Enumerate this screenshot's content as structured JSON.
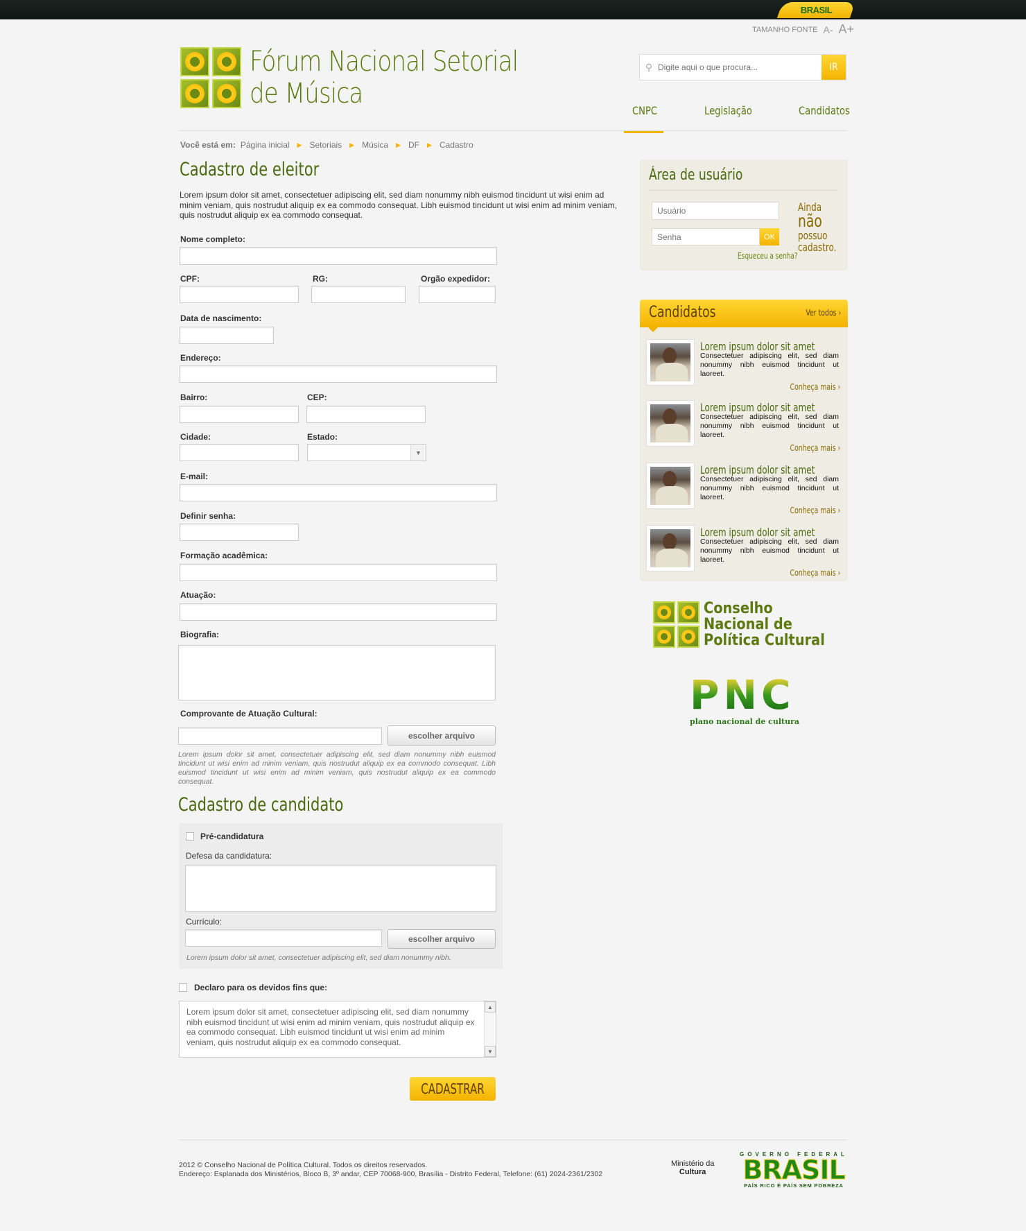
{
  "topbar": {
    "brasil_label": "BRASIL"
  },
  "font_controls": {
    "label": "TAMANHO FONTE",
    "decrease": "A-",
    "increase": "A+"
  },
  "site": {
    "title_line1": "Fórum Nacional Setorial",
    "title_line2": "de Música"
  },
  "search": {
    "placeholder": "Digite aqui o que procura...",
    "button": "IR",
    "icon": "search-icon"
  },
  "nav": {
    "items": [
      "CNPC",
      "Legislação",
      "Candidatos"
    ],
    "active": "CNPC",
    "accent_color": "#f4b300"
  },
  "breadcrumb": {
    "label": "Você está em:",
    "items": [
      "Página inicial",
      "Setoriais",
      "Música",
      "DF",
      "Cadastro"
    ]
  },
  "form": {
    "title": "Cadastro de eleitor",
    "intro": "Lorem ipsum dolor sit amet, consectetuer adipiscing elit, sed diam nonummy nibh euismod tincidunt ut wisi enim ad minim veniam, quis nostrudut aliquip ex ea commodo consequat. Libh euismod tincidunt ut wisi enim ad minim veniam, quis nostrudut aliquip ex ea commodo consequat.",
    "labels": {
      "nome": "Nome completo:",
      "cpf": "CPF:",
      "rg": "RG:",
      "orgao": "Orgão expedidor:",
      "nascimento": "Data de nascimento:",
      "endereco": "Endereço:",
      "bairro": "Bairro:",
      "cep": "CEP:",
      "cidade": "Cidade:",
      "estado": "Estado:",
      "email": "E-mail:",
      "senha": "Definir senha:",
      "formacao": "Formação acadêmica:",
      "atuacao": "Atuação:",
      "biografia": "Biografia:",
      "comprovante": "Comprovante de Atuação Cultural:"
    },
    "file_button": "escolher arquivo",
    "comprovante_note": "Lorem ipsum dolor sit amet, consectetuer adipiscing elit, sed diam nonummy nibh euismod tincidunt ut wisi enim ad minim veniam, quis nostrudut aliquip ex ea commodo consequat. Libh euismod tincidunt ut wisi enim ad minim veniam, quis nostrudut aliquip ex ea commodo consequat."
  },
  "candidate_form": {
    "title": "Cadastro de candidato",
    "pre_candidatura": "Pré-candidatura",
    "defesa_label": "Defesa da candidatura:",
    "curriculo_label": "Currículo:",
    "file_button": "escolher arquivo",
    "note": "Lorem ipsum dolor sit amet, consectetuer adipiscing elit, sed diam nonummy nibh."
  },
  "declaration": {
    "label": "Declaro para os devidos fins que:",
    "text": "Lorem ipsum dolor sit amet, consectetuer adipiscing elit, sed diam nonummy nibh euismod tincidunt ut wisi enim ad minim veniam, quis nostrudut aliquip ex ea commodo consequat. Libh euismod tincidunt ut wisi enim ad minim veniam, quis nostrudut aliquip ex ea commodo consequat."
  },
  "submit": {
    "label": "CADASTRAR"
  },
  "user_area": {
    "title": "Área de usuário",
    "user_placeholder": "Usuário",
    "password_placeholder": "Senha",
    "ok": "OK",
    "forgot": "Esqueceu a senha?",
    "not_registered_1": "Ainda",
    "not_registered_2": "não",
    "not_registered_3": "possuo",
    "not_registered_4": "cadastro."
  },
  "candidates": {
    "title": "Candidatos",
    "see_all": "Ver todos ›",
    "items": [
      {
        "name": "Lorem ipsum dolor sit amet",
        "desc": "Consectetuer adipiscing elit, sed diam nonummy nibh euismod tincidunt ut laoreet.",
        "more": "Conheça mais ›"
      },
      {
        "name": "Lorem ipsum dolor sit amet",
        "desc": "Consectetuer adipiscing elit, sed diam nonummy nibh euismod tincidunt ut laoreet.",
        "more": "Conheça mais ›"
      },
      {
        "name": "Lorem ipsum dolor sit amet",
        "desc": "Consectetuer adipiscing elit, sed diam nonummy nibh euismod tincidunt ut laoreet.",
        "more": "Conheça mais ›"
      },
      {
        "name": "Lorem ipsum dolor sit amet",
        "desc": "Consectetuer adipiscing elit, sed diam nonummy nibh euismod tincidunt ut laoreet.",
        "more": "Conheça mais ›"
      }
    ]
  },
  "partners": {
    "cnpc_line1": "Conselho",
    "cnpc_line2": "Nacional de",
    "cnpc_line3": "Política Cultural",
    "pnc_letters": "PNC",
    "pnc_sub": "plano nacional de cultura"
  },
  "footer": {
    "copyright": "2012 © Conselho Nacional de Política Cultural. Todos os direitos reservados.",
    "address": "Endereço: Esplanada dos Ministérios, Bloco B, 3º andar, CEP 70068-900, Brasília - Distrito Federal, Telefone: (61) 2024-2361/2302",
    "ministry_line1": "Ministério da",
    "ministry_line2": "Cultura",
    "gov_label": "GOVERNO FEDERAL",
    "gov_brand": "BRASIL",
    "gov_slogan": "PAÍS RICO É PAÍS SEM POBREZA"
  }
}
